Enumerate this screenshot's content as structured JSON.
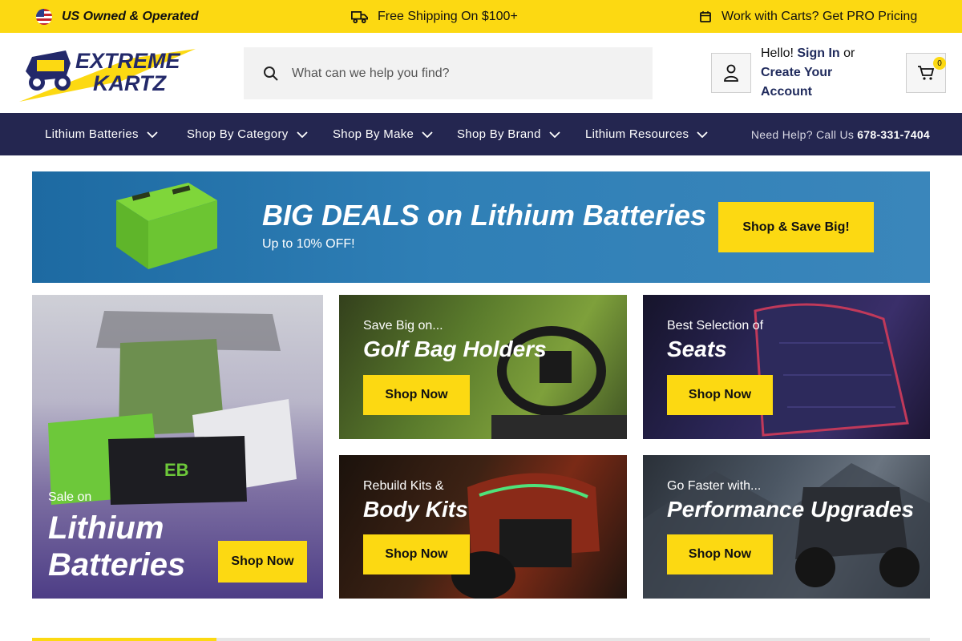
{
  "topbar": {
    "us_owned": "US Owned & Operated",
    "shipping": "Free Shipping On $100+",
    "pro": "Work with Carts? Get PRO Pricing"
  },
  "header": {
    "logo_line1": "EXTREME",
    "logo_line2": "KARTZ",
    "search_placeholder": "What can we help you find?",
    "hello": "Hello!",
    "sign_in": "Sign In",
    "or": "or",
    "create_account": "Create Your Account",
    "cart_count": "0"
  },
  "nav": {
    "items": [
      {
        "label": "Lithium Batteries"
      },
      {
        "label": "Shop By Category"
      },
      {
        "label": "Shop By Make"
      },
      {
        "label": "Shop By Brand"
      },
      {
        "label": "Lithium Resources"
      }
    ],
    "help_label": "Need Help? Call Us",
    "help_phone": "678-331-7404"
  },
  "hero": {
    "title": "BIG DEALS on Lithium Batteries",
    "subtitle": "Up to 10% OFF!",
    "cta": "Shop & Save Big!"
  },
  "tiles": {
    "lithium": {
      "pre": "Sale on",
      "head1": "Lithium",
      "head2": "Batteries",
      "btn": "Shop Now"
    },
    "golf": {
      "pre": "Save Big on...",
      "head": "Golf Bag Holders",
      "btn": "Shop Now"
    },
    "seats": {
      "pre": "Best Selection of",
      "head": "Seats",
      "btn": "Shop Now"
    },
    "body": {
      "pre": "Rebuild Kits &",
      "head": "Body Kits",
      "btn": "Shop Now"
    },
    "perf": {
      "pre": "Go Faster with...",
      "head": "Performance Upgrades",
      "btn": "Shop Now"
    }
  },
  "carousel_progress": 0.205,
  "colors": {
    "accent": "#fcd912",
    "nav_bg": "#242650",
    "hero_bg": "#2f7fb6"
  }
}
